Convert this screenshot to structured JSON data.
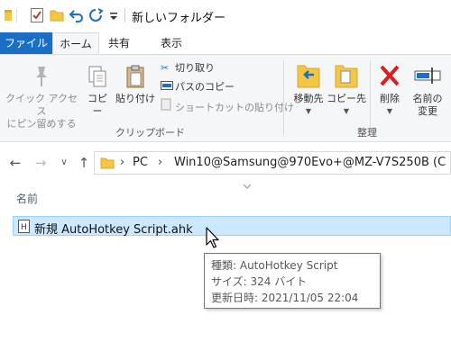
{
  "window": {
    "title": "新しいフォルダー"
  },
  "ribbon_tabs": {
    "file": "ファイル",
    "home": "ホーム",
    "share": "共有",
    "view": "表示"
  },
  "clipboard": {
    "pin": "クイック アクセス\nにピン留めする",
    "copy": "コピー",
    "paste": "貼り付け",
    "cut": "切り取り",
    "copy_path": "パスのコピー",
    "paste_shortcut": "ショートカットの貼り付け",
    "group_label": "クリップボード"
  },
  "organize": {
    "move_to": "移動先",
    "copy_to": "コピー先",
    "delete": "削除",
    "rename": "名前の\n変更",
    "group_label": "整理"
  },
  "address": {
    "crumb1": "PC",
    "crumb2": "Win10@Samsung@970Evo+@MZ-V7S250B (C"
  },
  "list": {
    "column_name": "名前",
    "file_name": "新規 AutoHotkey Script.ahk"
  },
  "tooltip": {
    "type": "種類: AutoHotkey Script",
    "size": "サイズ: 324 バイト",
    "modified": "更新日時: 2021/11/05 22:04"
  },
  "colors": {
    "file_tab": "#1a6fc4",
    "selection": "#cce8ff",
    "folder": "#f3c744",
    "delete_red": "#d81e1e"
  }
}
